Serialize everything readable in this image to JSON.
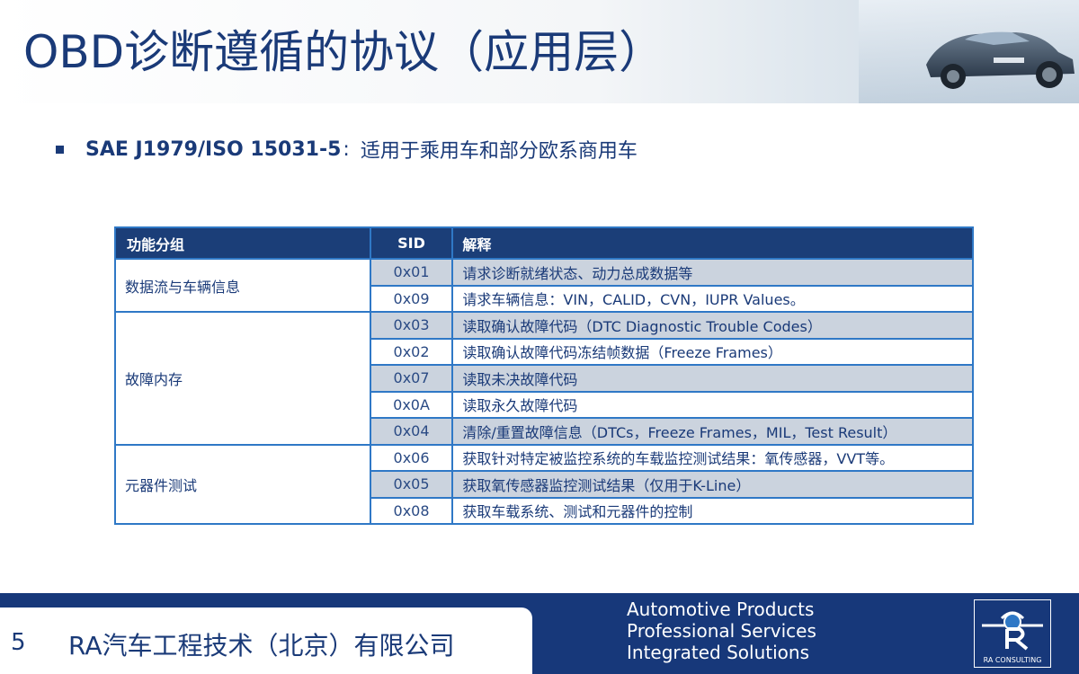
{
  "slide": {
    "title": "OBD诊断遵循的协议（应用层）",
    "bullet": {
      "standard": "SAE J1979/ISO 15031-5",
      "separator": ":",
      "description": "适用于乘用车和部分欧系商用车"
    }
  },
  "table": {
    "headers": [
      "功能分组",
      "SID",
      "解释"
    ],
    "groups": [
      {
        "name": "数据流与车辆信息",
        "rows": [
          {
            "sid": "0x01",
            "desc": "请求诊断就绪状态、动力总成数据等"
          },
          {
            "sid": "0x09",
            "desc": "请求车辆信息：VIN，CALID，CVN，IUPR Values。"
          }
        ]
      },
      {
        "name": "故障内存",
        "rows": [
          {
            "sid": "0x03",
            "desc": "读取确认故障代码（DTC Diagnostic Trouble Codes）"
          },
          {
            "sid": "0x02",
            "desc": "读取确认故障代码冻结帧数据（Freeze Frames）"
          },
          {
            "sid": "0x07",
            "desc": "读取未决故障代码"
          },
          {
            "sid": "0x0A",
            "desc": "读取永久故障代码"
          },
          {
            "sid": "0x04",
            "desc": "清除/重置故障信息（DTCs，Freeze Frames，MIL，Test Result）"
          }
        ]
      },
      {
        "name": "元器件测试",
        "rows": [
          {
            "sid": "0x06",
            "desc": "获取针对特定被监控系统的车载监控测试结果：氧传感器，VVT等。"
          },
          {
            "sid": "0x05",
            "desc": "获取氧传感器监控测试结果（仅用于K-Line）"
          },
          {
            "sid": "0x08",
            "desc": "获取车载系统、测试和元器件的控制"
          }
        ]
      }
    ]
  },
  "footer": {
    "page_number": "5",
    "company": "RA汽车工程技术（北京）有限公司",
    "tagline": [
      "Automotive Products",
      "Professional Services",
      "Integrated Solutions"
    ],
    "logo_text": "RA CONSULTING"
  },
  "colors": {
    "brand_blue": "#1a3a78",
    "header_row": "#1b3e78",
    "grid_line": "#2f78c6",
    "shaded_row": "#cbd3de"
  },
  "icons": [
    "car-image",
    "ra-logo-icon"
  ]
}
